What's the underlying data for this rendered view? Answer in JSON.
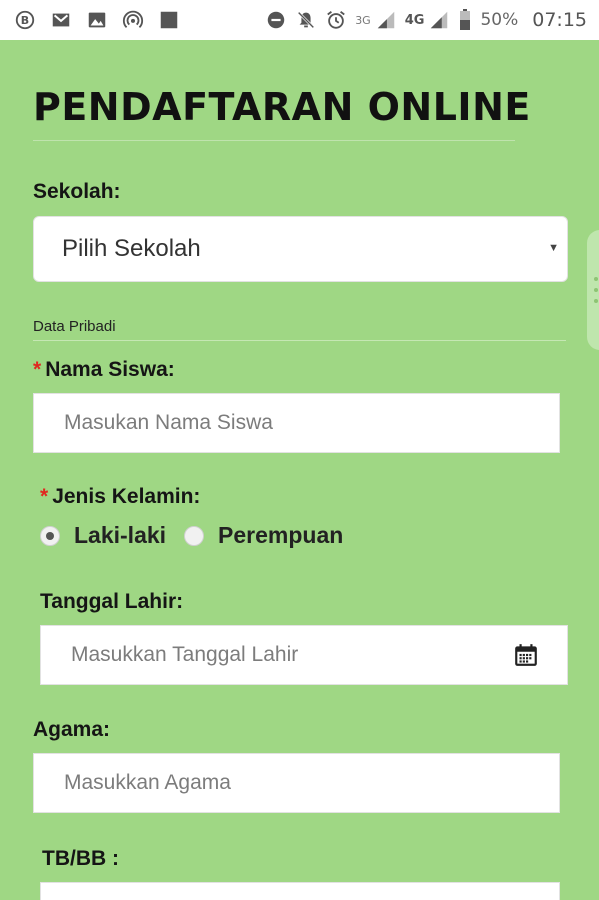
{
  "status_bar": {
    "left_icons": [
      "b-circle-icon",
      "gmail-icon",
      "image-icon",
      "hotspot-icon",
      "square-icon"
    ],
    "right_icons": [
      "do-not-disturb-icon",
      "bell-off-icon",
      "alarm-icon"
    ],
    "network_3g": "3G",
    "network_4g": "4G",
    "battery_percent": "50%",
    "time": "07:15"
  },
  "form": {
    "title": "PENDAFTARAN ONLINE",
    "school": {
      "label": "Sekolah:",
      "selected": "Pilih Sekolah"
    },
    "section_personal": "Data Pribadi",
    "name": {
      "required_mark": "*",
      "label": "Nama Siswa:",
      "placeholder": "Masukan Nama Siswa"
    },
    "gender": {
      "required_mark": "*",
      "label": "Jenis Kelamin:",
      "options": [
        "Laki-laki",
        "Perempuan"
      ],
      "selected_index": 0
    },
    "birth_date": {
      "label": "Tanggal Lahir:",
      "placeholder": "Masukkan Tanggal Lahir"
    },
    "religion": {
      "label": "Agama:",
      "placeholder": "Masukkan Agama"
    },
    "height_weight": {
      "label": "TB/BB :"
    }
  },
  "colors": {
    "page_bg": "#9fd784",
    "required": "#e0281f"
  }
}
